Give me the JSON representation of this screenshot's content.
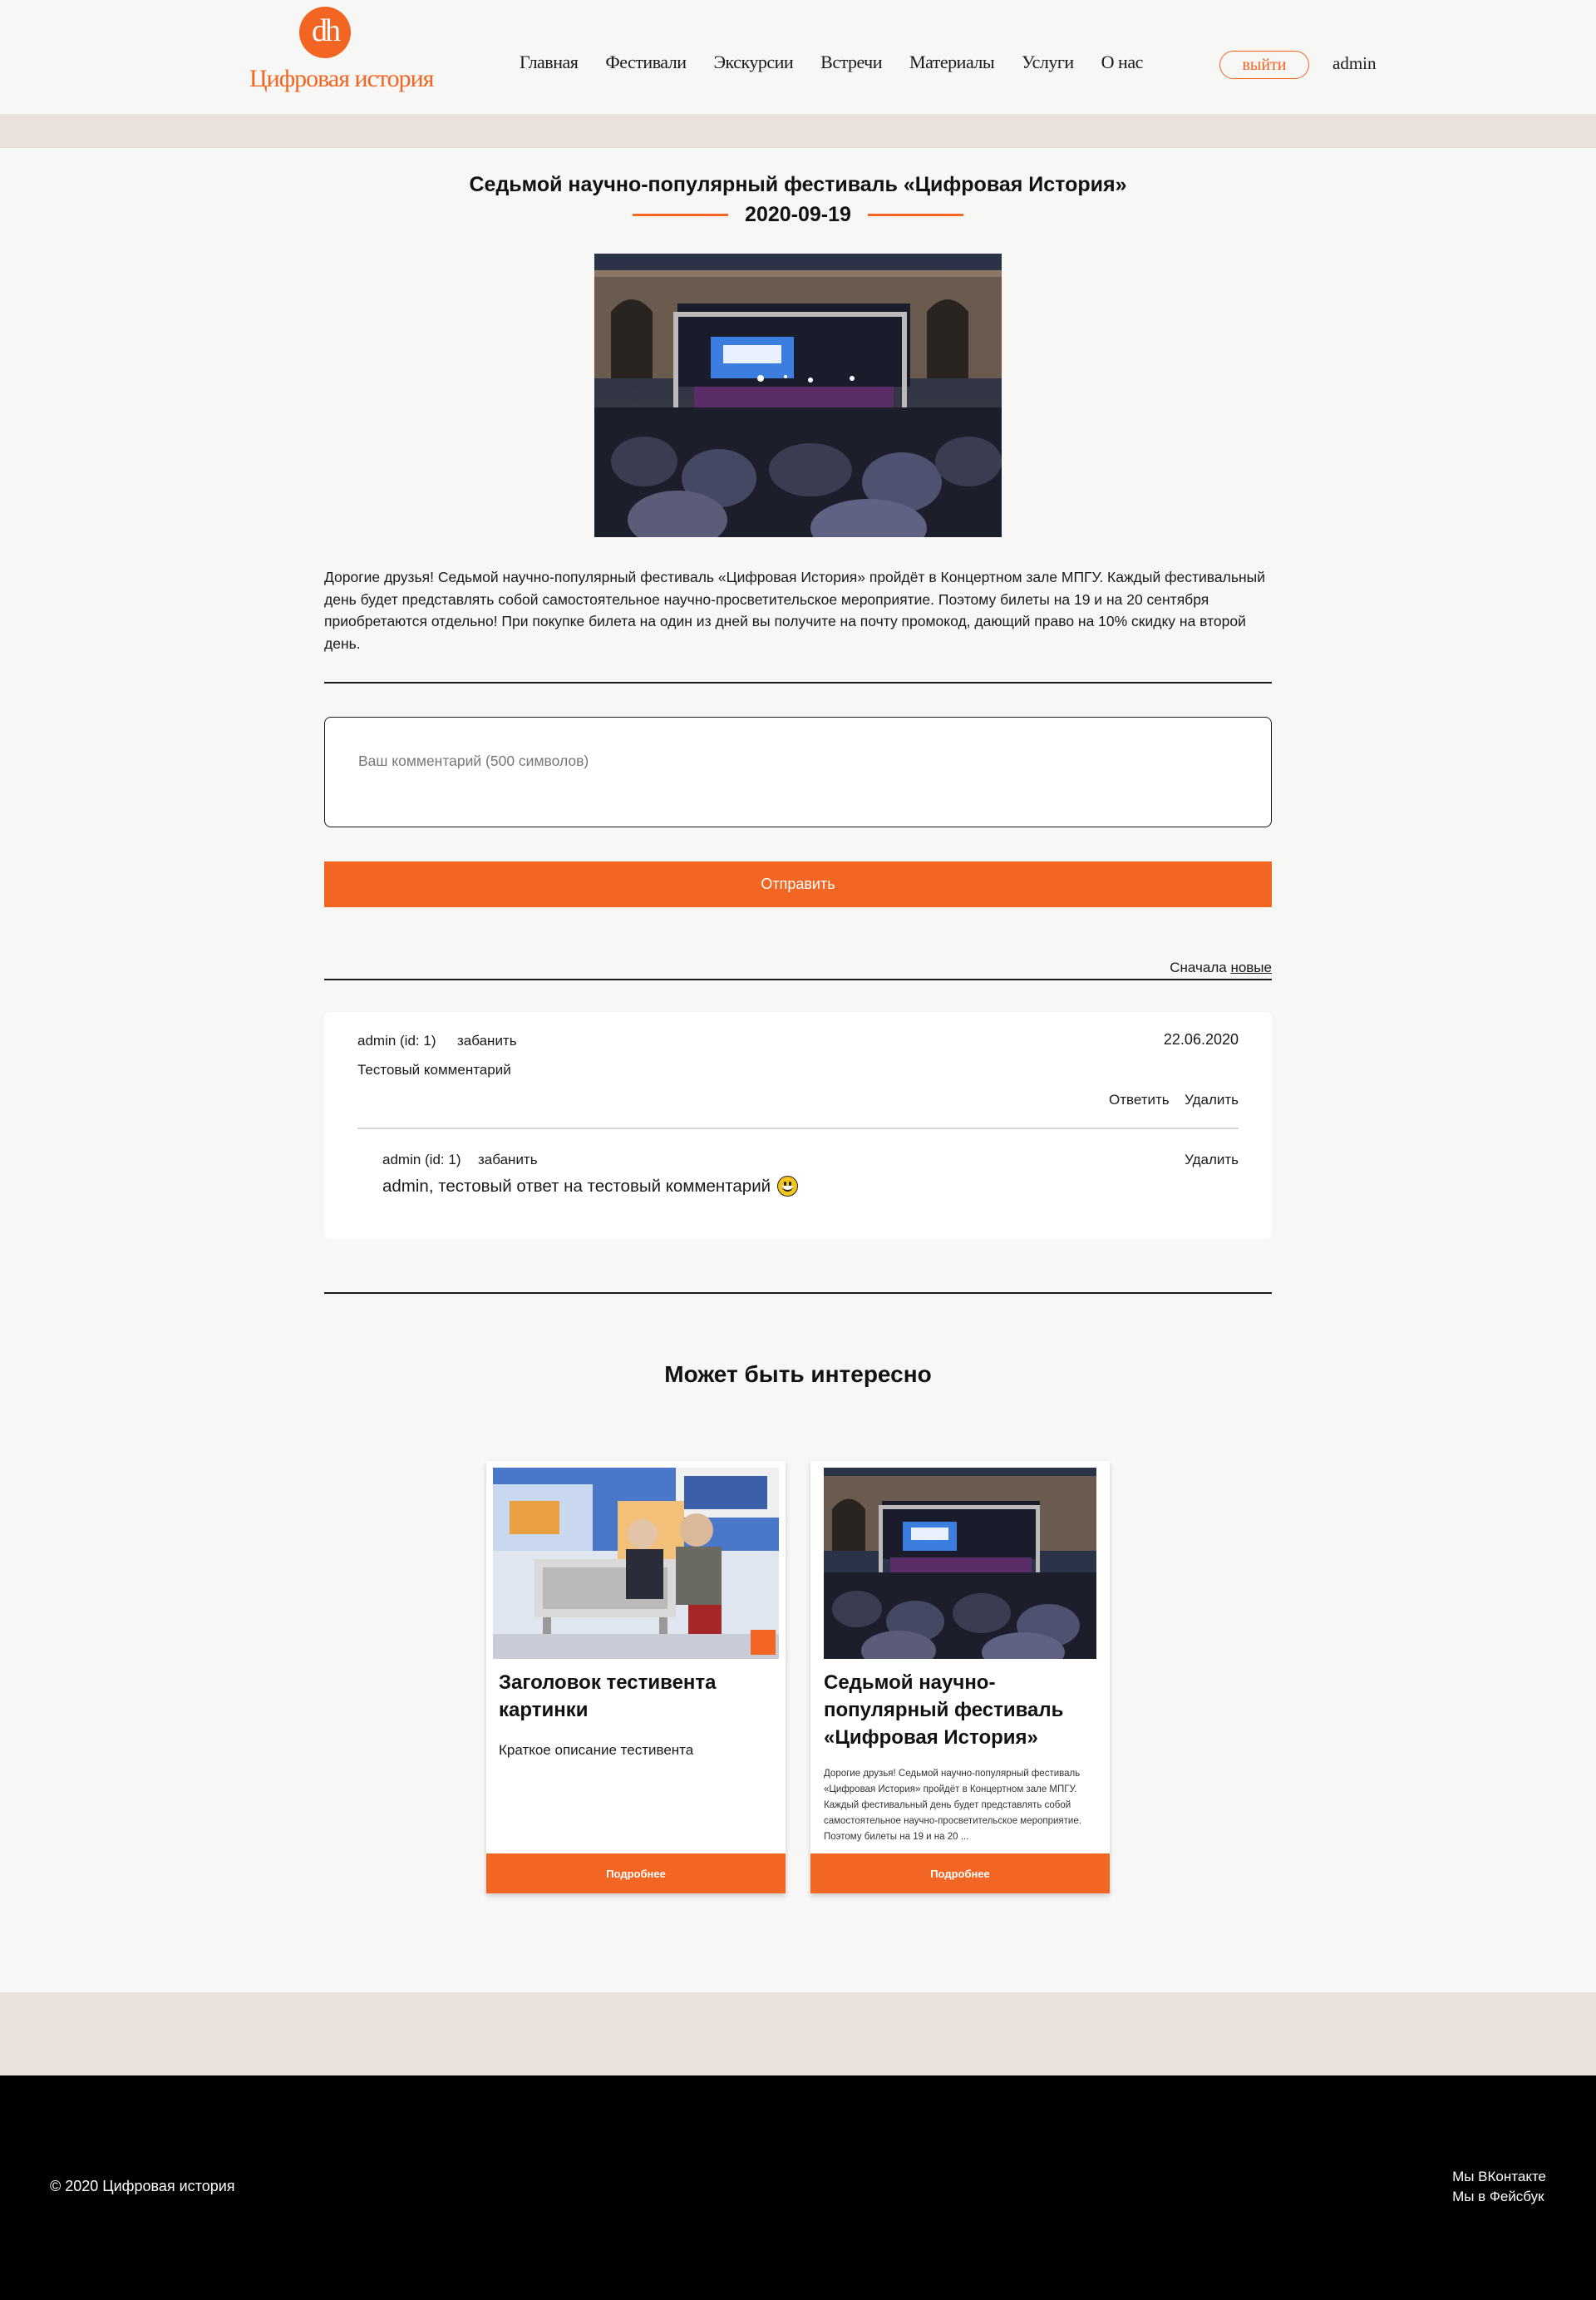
{
  "header": {
    "logo_mark": "dh",
    "logo_text": "Цифровая история",
    "nav": [
      "Главная",
      "Фестивали",
      "Экскурсии",
      "Встречи",
      "Материалы",
      "Услуги",
      "О нас"
    ],
    "logout_label": "выйти",
    "user_name": "admin"
  },
  "article": {
    "title": "Седьмой научно-популярный фестиваль «Цифровая История»",
    "date": "2020-09-19",
    "body": "Дорогие друзья! Седьмой научно-популярный фестиваль «Цифровая История» пройдёт в Концертном зале МПГУ. Каждый фестивальный день будет представлять собой самостоятельное научно-просветительское мероприятие. Поэтому билеты на 19 и на 20 сентября приобретаются отдельно! При покупке билета на один из дней вы получите на почту промокод, дающий право на 10% скидку на второй день."
  },
  "comment_form": {
    "placeholder": "Ваш комментарий (500 символов)",
    "submit_label": "Отправить"
  },
  "sort": {
    "prefix": "Сначала",
    "link": "новые"
  },
  "comments": [
    {
      "author": "admin (id: 1)",
      "ban_label": "забанить",
      "date": "22.06.2020",
      "text": "Тестовый комментарий",
      "reply_label": "Ответить",
      "delete_label": "Удалить",
      "replies": [
        {
          "author": "admin (id: 1)",
          "ban_label": "забанить",
          "delete_label": "Удалить",
          "text": "admin, тестовый ответ на тестовый комментарий"
        }
      ]
    }
  ],
  "related": {
    "title": "Может быть интересно",
    "cards": [
      {
        "title": "Заголовок тестивента картинки",
        "description": "Краткое описание тестивента",
        "button": "Подробнее"
      },
      {
        "title": "Седьмой научно-популярный фестиваль «Цифровая История»",
        "description": "Дорогие друзья! Седьмой научно-популярный фестиваль «Цифровая История» пройдёт в Концертном зале МПГУ. Каждый фестивальный день будет представлять собой самостоятельное научно-просветительское мероприятие. Поэтому билеты на 19 и на 20 ...",
        "button": "Подробнее"
      }
    ]
  },
  "footer": {
    "copyright": "© 2020 Цифровая история",
    "social": [
      "Мы ВКонтакте",
      "Мы в Фейсбук"
    ]
  },
  "colors": {
    "accent": "#f26522",
    "band": "#e9e1dc",
    "page_bg": "#f7f7f6",
    "footer_bg": "#000000"
  }
}
